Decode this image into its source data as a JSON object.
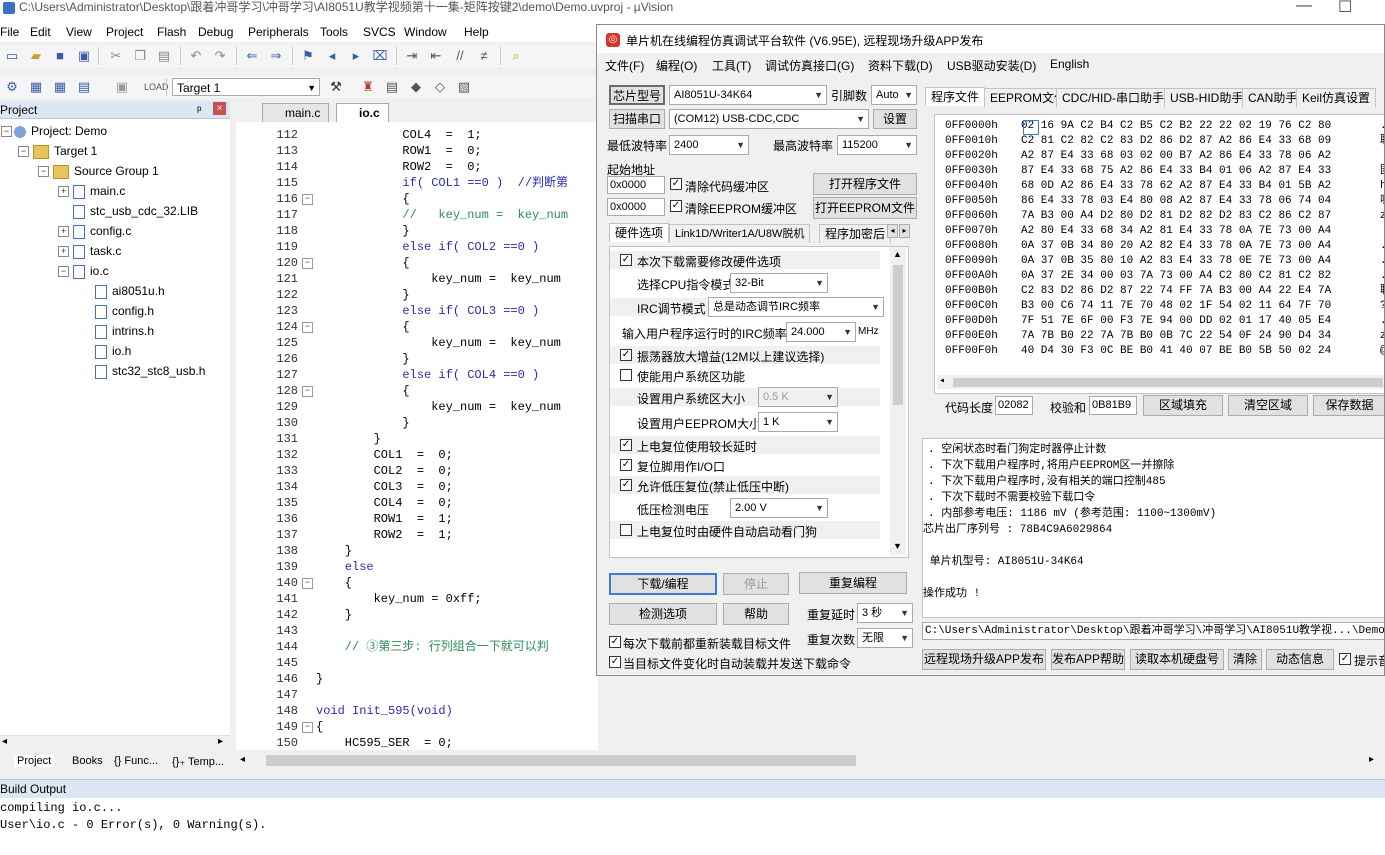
{
  "window": {
    "title": "C:\\Users\\Administrator\\Desktop\\跟着冲哥学习\\冲哥学习\\AI8051U教学视频第十一集-矩阵按键2\\demo\\Demo.uvproj - µVision",
    "minimize": "—",
    "maximize": "☐"
  },
  "menu": [
    "File",
    "Edit",
    "View",
    "Project",
    "Flash",
    "Debug",
    "Peripherals",
    "Tools",
    "SVCS",
    "Window",
    "Help"
  ],
  "toolbar": {
    "target": "Target 1"
  },
  "project_pane": {
    "title": "Project",
    "pin": "ᵖ",
    "close": "×",
    "tree": [
      {
        "label": "Project: Demo",
        "type": "project",
        "level": 0,
        "expanded": "−"
      },
      {
        "label": "Target 1",
        "type": "target",
        "level": 1,
        "expanded": "−"
      },
      {
        "label": "Source Group 1",
        "type": "group",
        "level": 2,
        "expanded": "−"
      },
      {
        "label": "main.c",
        "type": "file",
        "level": 3,
        "expanded": "+"
      },
      {
        "label": "stc_usb_cdc_32.LIB",
        "type": "file",
        "level": 3,
        "expanded": ""
      },
      {
        "label": "config.c",
        "type": "file",
        "level": 3,
        "expanded": "+"
      },
      {
        "label": "task.c",
        "type": "file",
        "level": 3,
        "expanded": "+"
      },
      {
        "label": "io.c",
        "type": "file",
        "level": 3,
        "expanded": "−"
      },
      {
        "label": "ai8051u.h",
        "type": "file",
        "level": 4,
        "expanded": ""
      },
      {
        "label": "config.h",
        "type": "file",
        "level": 4,
        "expanded": ""
      },
      {
        "label": "intrins.h",
        "type": "file",
        "level": 4,
        "expanded": ""
      },
      {
        "label": "io.h",
        "type": "file",
        "level": 4,
        "expanded": ""
      },
      {
        "label": "stc32_stc8_usb.h",
        "type": "file",
        "level": 4,
        "expanded": ""
      }
    ],
    "bottom_tabs": [
      "Project",
      "Books",
      "{} Func...",
      "{}₊ Temp..."
    ]
  },
  "editor": {
    "tabs": [
      {
        "label": "main.c",
        "active": false
      },
      {
        "label": "io.c",
        "active": true
      }
    ],
    "lines": [
      {
        "n": "112",
        "fold": "",
        "code": "            COL4  =  1;"
      },
      {
        "n": "113",
        "fold": "",
        "code": "            ROW1  =  0;"
      },
      {
        "n": "114",
        "fold": "",
        "code": "            ROW2  =  0;"
      },
      {
        "n": "115",
        "fold": "",
        "code": "            if( COL1 ==0 )  //判断第"
      },
      {
        "n": "116",
        "fold": "−",
        "code": "            {"
      },
      {
        "n": "117",
        "fold": "",
        "code": "            //   key_num =  key_num"
      },
      {
        "n": "118",
        "fold": "",
        "code": "            }"
      },
      {
        "n": "119",
        "fold": "",
        "code": "            else if( COL2 ==0 )"
      },
      {
        "n": "120",
        "fold": "−",
        "code": "            {"
      },
      {
        "n": "121",
        "fold": "",
        "code": "                key_num =  key_num"
      },
      {
        "n": "122",
        "fold": "",
        "code": "            }"
      },
      {
        "n": "123",
        "fold": "",
        "code": "            else if( COL3 ==0 )"
      },
      {
        "n": "124",
        "fold": "−",
        "code": "            {"
      },
      {
        "n": "125",
        "fold": "",
        "code": "                key_num =  key_num"
      },
      {
        "n": "126",
        "fold": "",
        "code": "            }"
      },
      {
        "n": "127",
        "fold": "",
        "code": "            else if( COL4 ==0 )"
      },
      {
        "n": "128",
        "fold": "−",
        "code": "            {"
      },
      {
        "n": "129",
        "fold": "",
        "code": "                key_num =  key_num"
      },
      {
        "n": "130",
        "fold": "",
        "code": "            }"
      },
      {
        "n": "131",
        "fold": "",
        "code": "        }"
      },
      {
        "n": "132",
        "fold": "",
        "code": "        COL1  =  0;"
      },
      {
        "n": "133",
        "fold": "",
        "code": "        COL2  =  0;"
      },
      {
        "n": "134",
        "fold": "",
        "code": "        COL3  =  0;"
      },
      {
        "n": "135",
        "fold": "",
        "code": "        COL4  =  0;"
      },
      {
        "n": "136",
        "fold": "",
        "code": "        ROW1  =  1;"
      },
      {
        "n": "137",
        "fold": "",
        "code": "        ROW2  =  1;"
      },
      {
        "n": "138",
        "fold": "",
        "code": "    }"
      },
      {
        "n": "139",
        "fold": "",
        "code": "    else"
      },
      {
        "n": "140",
        "fold": "−",
        "code": "    {"
      },
      {
        "n": "141",
        "fold": "",
        "code": "        key_num = 0xff;"
      },
      {
        "n": "142",
        "fold": "",
        "code": "    }"
      },
      {
        "n": "143",
        "fold": "",
        "code": ""
      },
      {
        "n": "144",
        "fold": "",
        "code": "    // ③第三步: 行列组合一下就可以判"
      },
      {
        "n": "145",
        "fold": "",
        "code": ""
      },
      {
        "n": "146",
        "fold": "",
        "code": "}"
      },
      {
        "n": "147",
        "fold": "",
        "code": ""
      },
      {
        "n": "148",
        "fold": "",
        "code": "void Init_595(void)"
      },
      {
        "n": "149",
        "fold": "−",
        "code": "{"
      },
      {
        "n": "150",
        "fold": "",
        "code": "    HC595_SER  = 0;"
      }
    ]
  },
  "build_output": {
    "title": "Build Output",
    "lines": [
      "compiling io.c...",
      "User\\io.c - 0 Error(s), 0 Warning(s)."
    ]
  },
  "isp": {
    "title": "单片机在线编程仿真调试平台软件 (V6.95E), 远程现场升级APP发布",
    "menu": [
      "文件(F)",
      "编程(O)",
      "工具(T)",
      "调试仿真接口(G)",
      "资料下载(D)",
      "USB驱动安装(D)",
      "English"
    ],
    "chip_btn": "芯片型号",
    "chip_model": "AI8051U-34K64",
    "pin_label": "引脚数",
    "pin_value": "Auto",
    "scan_btn": "扫描串口",
    "port": "(COM12) USB-CDC,CDC",
    "settings_btn": "设置",
    "min_baud_label": "最低波特率",
    "min_baud": "2400",
    "max_baud_label": "最高波特率",
    "max_baud": "115200",
    "start_addr_label": "起始地址",
    "addr1": "0x0000",
    "clear_code": "清除代码缓冲区",
    "open_prog": "打开程序文件",
    "addr2": "0x0000",
    "clear_eeprom": "清除EEPROM缓冲区",
    "open_eeprom": "打开EEPROM文件",
    "opt_tabs": [
      "硬件选项",
      "Link1D/Writer1A/U8W脱机",
      "程序加密后"
    ],
    "options": [
      {
        "kind": "check",
        "checked": true,
        "label": "本次下载需要修改硬件选项"
      },
      {
        "kind": "combo",
        "label": "选择CPU指令模式",
        "value": "32-Bit"
      },
      {
        "kind": "combo",
        "label": "IRC调节模式",
        "value": "总是动态调节IRC频率"
      },
      {
        "kind": "freq",
        "label": "输入用户程序运行时的IRC频率",
        "value": "24.000",
        "unit": "MHz"
      },
      {
        "kind": "check",
        "checked": true,
        "label": "振荡器放大增益(12M以上建议选择)"
      },
      {
        "kind": "check",
        "checked": false,
        "label": "使能用户系统区功能"
      },
      {
        "kind": "combo",
        "label": "设置用户系统区大小",
        "value": "0.5 K",
        "disabled": true
      },
      {
        "kind": "combo",
        "label": "设置用户EEPROM大小",
        "value": "1   K"
      },
      {
        "kind": "check",
        "checked": true,
        "label": "上电复位使用较长延时"
      },
      {
        "kind": "check",
        "checked": true,
        "label": "复位脚用作I/O口"
      },
      {
        "kind": "check",
        "checked": true,
        "label": "允许低压复位(禁止低压中断)"
      },
      {
        "kind": "combo",
        "label": "低压检测电压",
        "value": "2.00 V"
      },
      {
        "kind": "check",
        "checked": false,
        "label": "上电复位时由硬件自动启动看门狗"
      }
    ],
    "download_btn": "下载/编程",
    "stop_btn": "停止",
    "reprogram_btn": "重复编程",
    "detect_btn": "检测选项",
    "help_btn": "帮助",
    "repeat_delay_label": "重复延时",
    "repeat_delay": "3 秒",
    "repeat_count_label": "重复次数",
    "repeat_count": "无限",
    "reload_check": "每次下载前都重新装载目标文件",
    "auto_check": "当目标文件变化时自动装载并发送下载命令",
    "right_tabs": [
      "程序文件",
      "EEPROM文件",
      "CDC/HID-串口助手",
      "USB-HID助手",
      "CAN助手",
      "Keil仿真设置"
    ],
    "hex_rows": [
      {
        "addr": "0FF0000h",
        "bytes": "02 16 9A C2 B4 C2 B5 C2 B2 22 22 02 19 76 C2 80",
        "ascii": "..."
      },
      {
        "addr": "0FF0010h",
        "bytes": "C2 81 C2 82 C2 83 D2 86 D2 87 A2 86 E4 33 68 09",
        "ascii": "聁"
      },
      {
        "addr": "0FF0020h",
        "bytes": "A2 87 E4 33 68 03 02 00 B7 A2 86 E4 33 78 06 A2",
        "ascii": ""
      },
      {
        "addr": "0FF0030h",
        "bytes": "87 E4 33 68 75 A2 86 E4 33 B4 01 06 A2 87 E4 33",
        "ascii": "囷"
      },
      {
        "addr": "0FF0040h",
        "bytes": "68 0D A2 86 E4 33 78 62 A2 87 E4 33 B4 01 5B A2",
        "ascii": "h."
      },
      {
        "addr": "0FF0050h",
        "bytes": "86 E4 33 78 03 E4 80 08 A2 87 E4 33 78 06 74 04",
        "ascii": "嗕"
      },
      {
        "addr": "0FF0060h",
        "bytes": "7A B3 00 A4 D2 80 D2 81 D2 82 D2 83 C2 86 C2 87",
        "ascii": "z?"
      },
      {
        "addr": "0FF0070h",
        "bytes": "A2 80 E4 33 68 34 A2 81 E4 33 78 0A 7E 73 00 A4",
        "ascii": ""
      },
      {
        "addr": "0FF0080h",
        "bytes": "0A 37 0B 34 80 20 A2 82 E4 33 78 0A 7E 73 00 A4",
        "ascii": ".7"
      },
      {
        "addr": "0FF0090h",
        "bytes": "0A 37 0B 35 80 10 A2 83 E4 33 78 0E 7E 73 00 A4",
        "ascii": ".7"
      },
      {
        "addr": "0FF00A0h",
        "bytes": "0A 37 2E 34 00 03 7A 73 00 A4 C2 80 C2 81 C2 82",
        "ascii": ".7"
      },
      {
        "addr": "0FF00B0h",
        "bytes": "C2 83 D2 86 D2 87 22 74 FF 7A B3 00 A4 22 E4 7A",
        "ascii": "聝"
      },
      {
        "addr": "0FF00C0h",
        "bytes": "B3 00 C6 74 11 7E 70 48 02 1F 54 02 11 64 7F 70",
        "ascii": "?Ɨ"
      },
      {
        "addr": "0FF00D0h",
        "bytes": "7F 51 7E 6F 00 F3 7E 94 00 DD 02 01 17 40 05 E4",
        "ascii": ".Q"
      },
      {
        "addr": "0FF00E0h",
        "bytes": "7A 7B B0 22 7A 7B B0 0B 7C 22 54 0F 24 90 D4 34",
        "ascii": "z{"
      },
      {
        "addr": "0FF00F0h",
        "bytes": "40 D4 30 F3 0C BE B0 41 40 07 BE B0 5B 50 02 24",
        "ascii": "@?"
      }
    ],
    "code_len_label": "代码长度",
    "code_len": "02082",
    "checksum_label": "校验和",
    "checksum": "0B81B9",
    "fill_btn": "区域填充",
    "clear_btn": "清空区域",
    "save_btn": "保存数据",
    "log_lines": [
      ". 空闲状态时看门狗定时器停止计数",
      ". 下次下载用户程序时,将用户EEPROM区一并擦除",
      ". 下次下载用户程序时,没有相关的端口控制485",
      ". 下次下载时不需要校验下载口令",
      ". 内部参考电压: 1186 mV (参考范围: 1100~1300mV)",
      "芯片出厂序列号 : 78B4C9A6029864",
      "",
      " 单片机型号: AI8051U-34K64",
      "",
      "操作成功 !"
    ],
    "path": "C:\\Users\\Administrator\\Desktop\\跟着冲哥学习\\冲哥学习\\AI8051U教学视...\\Demo.hex",
    "bottom_btns": [
      "远程现场升级APP发布",
      "发布APP帮助",
      "读取本机硬盘号",
      "清除",
      "动态信息"
    ],
    "prompt_check": "提示音"
  }
}
